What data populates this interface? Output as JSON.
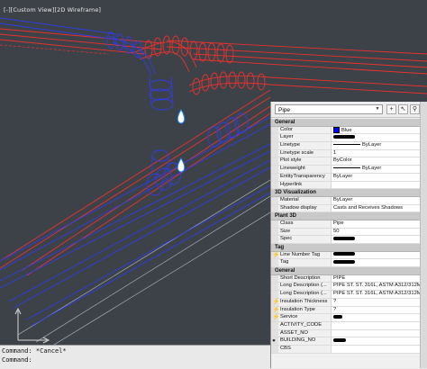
{
  "viewport": {
    "title_prefix": "[-]",
    "view": "[Custom View]",
    "visual_style": "[2D Wireframe]"
  },
  "command_line": {
    "lines": [
      "Command: *Cancel*",
      "Command:"
    ]
  },
  "properties": {
    "object_type": "Pipe",
    "sections": {
      "general": "General",
      "visualization": "3D Visualization",
      "plant3d": "Plant 3D",
      "tag": "Tag",
      "general2": "General"
    },
    "general_rows": [
      {
        "label": "Color",
        "value": "Blue"
      },
      {
        "label": "Layer",
        "value": ""
      },
      {
        "label": "Linetype",
        "value": "ByLayer"
      },
      {
        "label": "Linetype scale",
        "value": "1"
      },
      {
        "label": "Plot style",
        "value": "ByColor"
      },
      {
        "label": "Lineweight",
        "value": "ByLayer"
      },
      {
        "label": "EntityTransparency",
        "value": "ByLayer"
      },
      {
        "label": "Hyperlink",
        "value": ""
      }
    ],
    "visualization_rows": [
      {
        "label": "Material",
        "value": "ByLayer"
      },
      {
        "label": "Shadow display",
        "value": "Casts and Receives Shadows"
      }
    ],
    "plant3d_rows": [
      {
        "label": "Class",
        "value": "Pipe"
      },
      {
        "label": "Size",
        "value": "50"
      },
      {
        "label": "Spec",
        "value": ""
      }
    ],
    "tag_rows": [
      {
        "label": "Line Number Tag",
        "value": ""
      },
      {
        "label": "Tag",
        "value": ""
      }
    ],
    "general2_rows": [
      {
        "label": "Short Description",
        "value": "PIPE"
      },
      {
        "label": "Long Description (...",
        "value": "PIPE ST. ST. 316L, ASTM A312/312M ..."
      },
      {
        "label": "Long Description (...",
        "value": "PIPE ST. ST. 316L, ASTM A312/312M ..."
      },
      {
        "label": "Insulation Thickness",
        "value": "?"
      },
      {
        "label": "Insulation Type",
        "value": "?"
      },
      {
        "label": "Service",
        "value": ""
      },
      {
        "label": "ACTIVITY_CODE",
        "value": ""
      },
      {
        "label": "ASSET_NO",
        "value": ""
      },
      {
        "label": "BUILDING_NO",
        "value": ""
      },
      {
        "label": "CBS",
        "value": ""
      }
    ],
    "colors": {
      "color_swatch": "#0000ff",
      "pipe_red": "#e8322e",
      "pipe_blue": "#2f3de6"
    }
  }
}
